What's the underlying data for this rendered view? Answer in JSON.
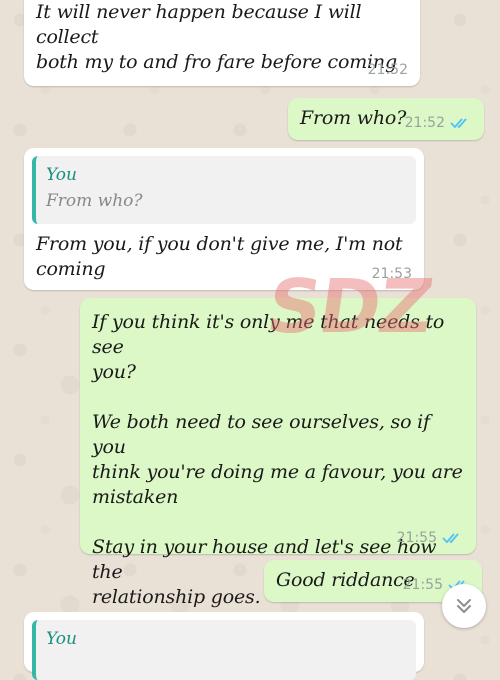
{
  "messages": [
    {
      "text": "It will never happen because I will collect\nboth my to and fro fare before coming",
      "time": "21:52"
    },
    {
      "text": "From who?",
      "time": "21:52",
      "status": "read"
    },
    {
      "quote_author": "You",
      "quote_text": "From who?",
      "text": "From you, if you don't give me, I'm not\ncoming",
      "time": "21:53"
    },
    {
      "text": "If you think it's only me that needs to see\nyou?\n\nWe both need to see ourselves, so if you\nthink you're doing me a favour, you are\nmistaken\n\nStay in your house and let's see how the\nrelationship goes.",
      "time": "21:55",
      "status": "read"
    },
    {
      "text": "Good riddance",
      "time": "21:55",
      "status": "read"
    },
    {
      "quote_author": "You"
    }
  ],
  "watermark": "SDZ",
  "scroll_button": {
    "icon": "double-chevron-down-icon"
  },
  "colors": {
    "chat_background": "#e9e1d6",
    "incoming_bubble": "#ffffff",
    "outgoing_bubble": "#dcf8c6",
    "read_ticks": "#4fc3f7",
    "quote_bar": "#34b7a7",
    "quote_author": "#1a8f80",
    "timestamp": "#9aa39b",
    "watermark": "#e86e6e"
  }
}
